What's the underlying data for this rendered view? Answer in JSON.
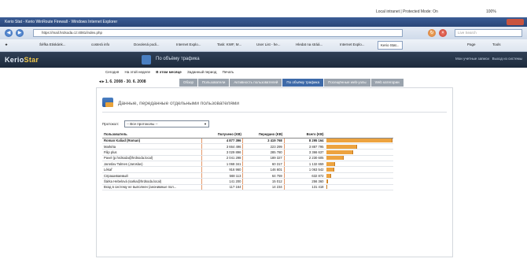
{
  "os_status": {
    "zone": "Local intranet | Protected Mode: On",
    "zoom": "100%"
  },
  "window": {
    "title": "Kerio Stat - Kerio WinRoute Firewall - Windows Internet Explorer"
  },
  "browser": {
    "url": "https://mail.hrdsoda.cz:4081/index.php",
    "search_placeholder": "Live Search",
    "favorites": [
      "Šéfka Etiskánk...",
      "costerá info",
      "Dovolená podi...",
      "Internet Explo...",
      "Task: KWF, M...",
      "User List - he...",
      "Hledat na stráá...",
      "Internet Explo...",
      "Kerio Stat...",
      "Page",
      "Tools"
    ]
  },
  "app": {
    "logo_main": "Kerio",
    "logo_accent": "Star",
    "page_title": "По объёму трафика",
    "header_links": [
      "Мои учетные записи",
      "Выход из системы"
    ]
  },
  "filters": [
    "Сегодня",
    "На этой неделе",
    "В этом месяце",
    "Заданный период",
    "Печать"
  ],
  "date_range": "1. 6. 2008 - 30. 6. 2008",
  "tabs": [
    {
      "label": "Обзор",
      "active": false
    },
    {
      "label": "Пользователи",
      "active": false
    },
    {
      "label": "Активность пользователей",
      "active": false
    },
    {
      "label": "По объёму трафика",
      "active": true
    },
    {
      "label": "Посещённые web-узлы",
      "active": false
    },
    {
      "label": "Web категории",
      "active": false
    }
  ],
  "panel": {
    "title": "Данные, переданные отдельными пользователями",
    "protocol_label": "Протокол:",
    "protocol_value": "-- Все протоколы --"
  },
  "table": {
    "headers": [
      "Пользователь",
      "Получено (KB)",
      "Передано (KB)",
      "Всего (KB)"
    ],
    "rows": [
      {
        "user": "Roman Kaliad (Roman)",
        "received": "4 877 396",
        "sent": "3 419 768",
        "total": "8 295 164",
        "share": 1.0
      },
      {
        "user": "Markéta",
        "received": "3 664 496",
        "sent": "223 299",
        "total": "3 887 795",
        "share": 0.47
      },
      {
        "user": "Filip plus",
        "received": "3 029 896",
        "sent": "285 780",
        "total": "3 366 637",
        "share": 0.41
      },
      {
        "user": "Pavel (p.hrdsoda@hrdsoda.local)",
        "received": "2 041 298",
        "sent": "189 327",
        "total": "2 230 605",
        "share": 0.27
      },
      {
        "user": "Jaroslav Talmes (Jaroslav)",
        "received": "1 068 341",
        "sent": "60 317",
        "total": "1 132 659",
        "share": 0.14
      },
      {
        "user": "Lékař",
        "received": "916 960",
        "sent": "146 601",
        "total": "1 063 542",
        "share": 0.13
      },
      {
        "user": "Спрашиваемый",
        "received": "568 113",
        "sent": "64 759",
        "total": "632 872",
        "share": 0.08
      },
      {
        "user": "Šárka Hebelová (sarka@hrdsoda.local)",
        "received": "141 200",
        "sent": "15 012",
        "total": "256 360",
        "share": 0.03
      },
      {
        "user": "Вход в систему не выполнен (анонимные пол...",
        "received": "117 164",
        "sent": "14 234",
        "total": "131 418",
        "share": 0.016
      }
    ]
  },
  "colors": {
    "bar": "#eda33f",
    "active_tab": "#3e6aa8",
    "header_bg": "#1d2a3c"
  }
}
